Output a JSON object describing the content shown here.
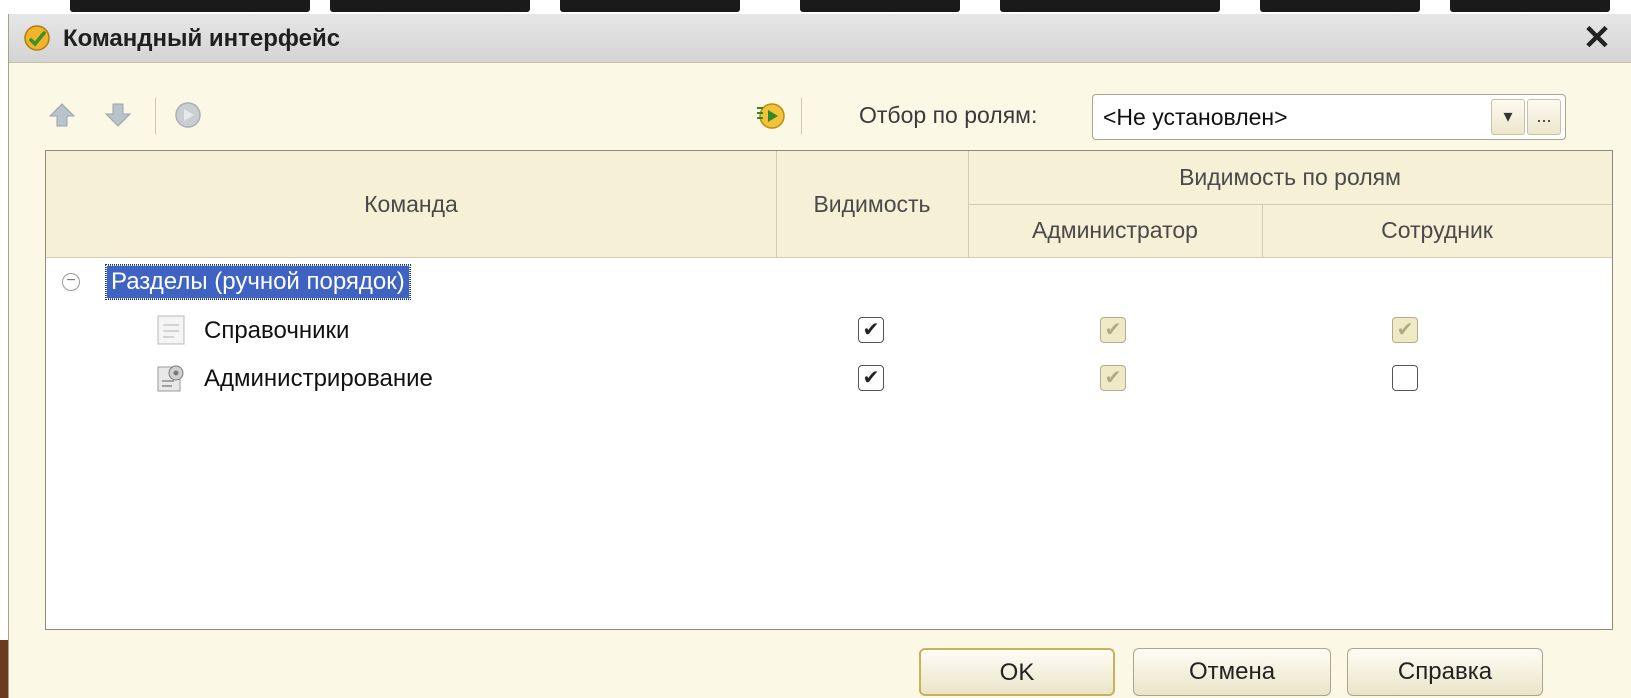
{
  "window": {
    "title": "Командный интерфейс",
    "close_glyph": "✕"
  },
  "toolbar": {
    "move_up_icon": "arrow-up-icon",
    "move_down_icon": "arrow-down-icon",
    "refresh_icon": "refresh-icon",
    "run_icon": "run-icon",
    "filter_label": "Отбор по ролям:",
    "filter_value": "<Не установлен>",
    "dropdown_glyph": "▾",
    "ellipsis_glyph": "..."
  },
  "table": {
    "columns": {
      "command": "Команда",
      "visibility": "Видимость",
      "visibility_by_roles": "Видимость по ролям",
      "role_admin": "Администратор",
      "role_employee": "Сотрудник"
    },
    "group": {
      "label": "Разделы (ручной порядок)",
      "expand_glyph": "−"
    },
    "rows": [
      {
        "label": "Справочники",
        "icon": "catalog-icon",
        "visible": true,
        "admin": true,
        "employee": true
      },
      {
        "label": "Администрирование",
        "icon": "administration-icon",
        "visible": true,
        "admin": true,
        "employee": false
      }
    ]
  },
  "buttons": {
    "ok": "OK",
    "cancel": "Отмена",
    "help": "Справка"
  },
  "colors": {
    "dialog_bg": "#fbf8e6",
    "header_bg": "#f5f0d6",
    "selection": "#3f63c2"
  },
  "check_glyph": "✔"
}
